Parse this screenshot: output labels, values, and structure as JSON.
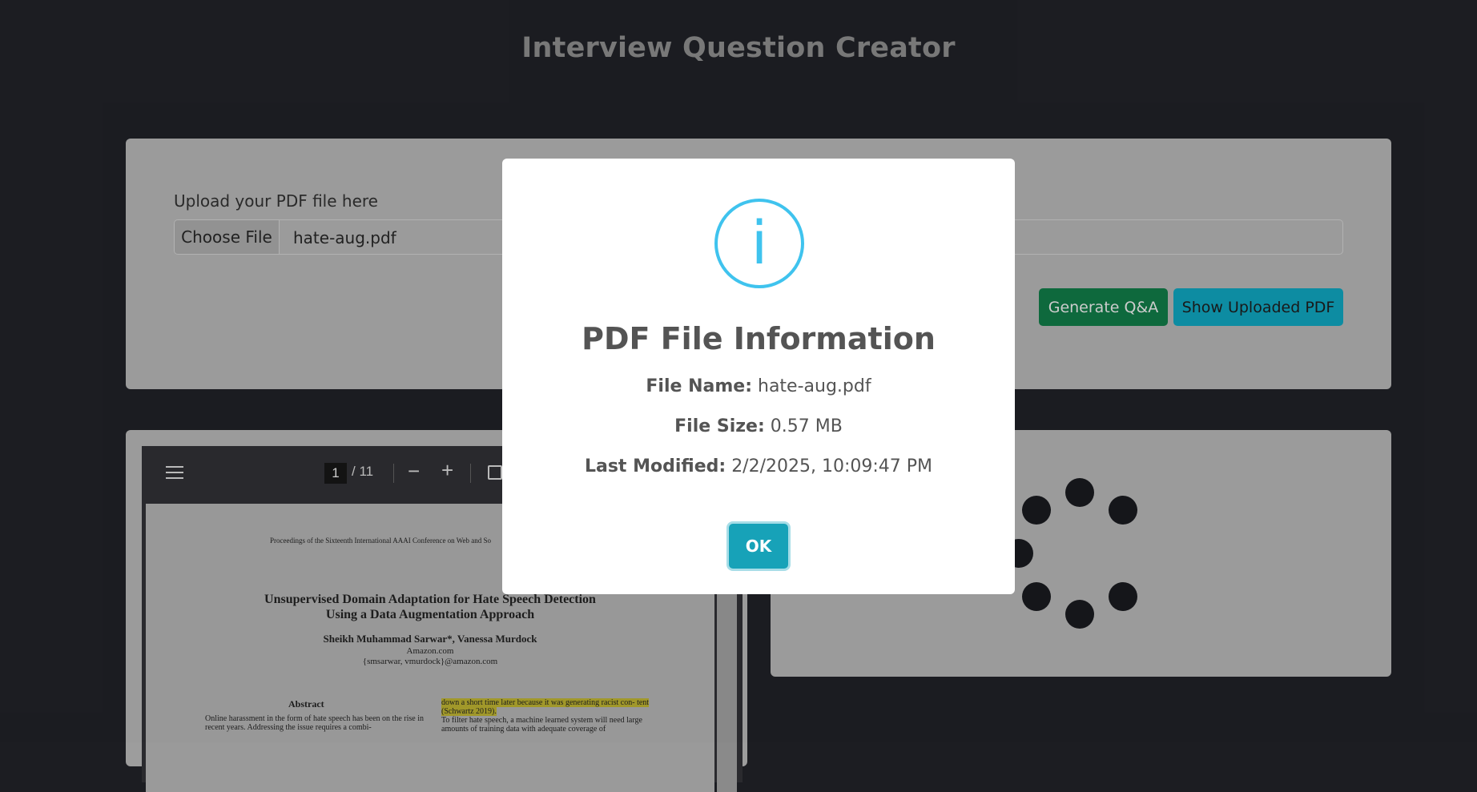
{
  "app": {
    "title": "Interview Question Creator"
  },
  "upload": {
    "label": "Upload your PDF file here",
    "choose_label": "Choose File",
    "file_name": "hate-aug.pdf",
    "generate_label": "Generate Q&A",
    "show_label": "Show Uploaded PDF"
  },
  "viewer": {
    "page_current": "1",
    "page_total": "/ 11",
    "proceedings": "Proceedings of the Sixteenth International AAAI Conference on Web and So",
    "title_line1": "Unsupervised Domain Adaptation for Hate Speech Detection",
    "title_line2": "Using a Data Augmentation Approach",
    "authors": "Sheikh Muhammad Sarwar*, Vanessa Murdock",
    "affiliation1": "Amazon.com",
    "affiliation2": "{smsarwar, vmurdock}@amazon.com",
    "abstract_heading": "Abstract",
    "abstract_text": "Online harassment in the form of hate speech has been on the rise in recent years. Addressing the issue requires a combi-",
    "right_highlight": "down a short time later because it was generating racist con- tent (Schwartz 2019).",
    "right_text": "To filter hate speech, a machine learned system will need large amounts of training data with adequate coverage of"
  },
  "modal": {
    "icon": "info-icon",
    "title": "PDF File Information",
    "file_name_label": "File Name:",
    "file_name_value": "hate-aug.pdf",
    "file_size_label": "File Size:",
    "file_size_value": "0.57 MB",
    "modified_label": "Last Modified:",
    "modified_value": "2/2/2025, 10:09:47 PM",
    "ok_label": "OK"
  },
  "colors": {
    "background": "#1c1d22",
    "panel": "#9d9d9d",
    "info_accent": "#3fc3ee",
    "ok_button": "#17a2b8",
    "generate_button": "#0f6b3e",
    "show_button": "#0e8ea4"
  }
}
